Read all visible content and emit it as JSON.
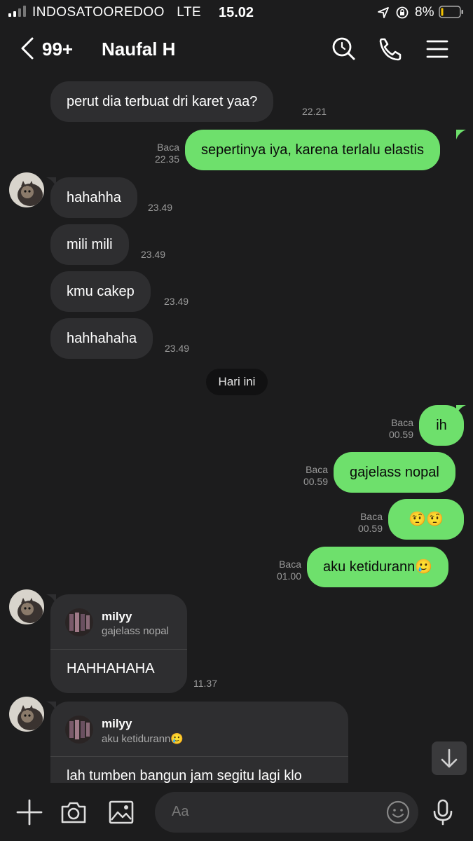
{
  "status_bar": {
    "carrier": "INDOSATOOREDOO",
    "network": "LTE",
    "time": "15.02",
    "battery": "8%"
  },
  "header": {
    "unread_count": "99+",
    "contact_name": "Naufal H"
  },
  "messages": [
    {
      "dir": "in",
      "text": "perut dia terbuat dri karet yaa?",
      "time": "22.21"
    },
    {
      "dir": "out",
      "text": "sepertinya iya, karena terlalu elastis",
      "read": "Baca",
      "time": "22.35"
    },
    {
      "dir": "in",
      "text": "hahahha",
      "time": "23.49"
    },
    {
      "dir": "in",
      "text": "mili mili",
      "time": "23.49"
    },
    {
      "dir": "in",
      "text": "kmu cakep",
      "time": "23.49"
    },
    {
      "dir": "in",
      "text": "hahhahaha",
      "time": "23.49"
    },
    {
      "dir": "out",
      "text": "ih",
      "read": "Baca",
      "time": "00.59"
    },
    {
      "dir": "out",
      "text": "gajelass nopal",
      "read": "Baca",
      "time": "00.59"
    },
    {
      "dir": "out",
      "text": "🤨🤨",
      "read": "Baca",
      "time": "00.59"
    },
    {
      "dir": "out",
      "text": "aku ketidurann🥲",
      "read": "Baca",
      "time": "01.00"
    }
  ],
  "date_divider": "Hari ini",
  "replies": [
    {
      "reply_to": "milyy",
      "quoted": "gajelass nopal",
      "text": "HAHHAHAHA",
      "time": "11.37"
    },
    {
      "reply_to": "milyy",
      "quoted": "aku ketidurann🥲",
      "text": "lah tumben bangun jam segitu lagi klo"
    }
  ],
  "composer": {
    "placeholder": "Aa"
  },
  "icons": {
    "header": [
      "back-chevron-icon",
      "search-icon",
      "phone-icon",
      "menu-icon"
    ],
    "composer": [
      "plus-icon",
      "camera-icon",
      "image-icon",
      "emoji-icon",
      "microphone-icon"
    ],
    "scroll": "arrow-down-icon"
  },
  "colors": {
    "background": "#1c1c1d",
    "incoming_bubble": "#2e2e30",
    "outgoing_bubble": "#6ee06c"
  }
}
